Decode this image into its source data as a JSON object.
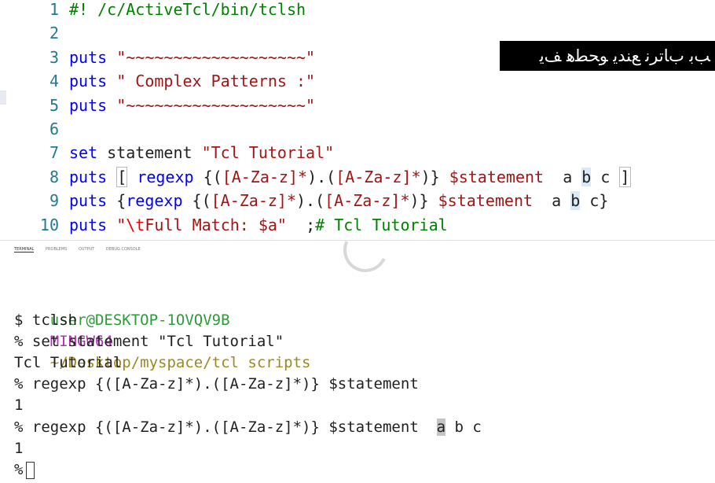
{
  "editor": {
    "lines": [
      {
        "num": "1",
        "tokens": [
          {
            "t": "#! /c/ActiveTcl/bin/tclsh",
            "c": "cmt"
          }
        ]
      },
      {
        "num": "2",
        "tokens": []
      },
      {
        "num": "3",
        "tokens": [
          {
            "t": "puts",
            "c": "kw"
          },
          {
            "t": " ",
            "c": ""
          },
          {
            "t": "\"~~~~~~~~~~~~~~~~~~~\"",
            "c": "str"
          }
        ]
      },
      {
        "num": "4",
        "tokens": [
          {
            "t": "puts",
            "c": "kw"
          },
          {
            "t": " ",
            "c": ""
          },
          {
            "t": "\" Complex Patterns :\"",
            "c": "str"
          }
        ]
      },
      {
        "num": "5",
        "tokens": [
          {
            "t": "puts",
            "c": "kw"
          },
          {
            "t": " ",
            "c": ""
          },
          {
            "t": "\"~~~~~~~~~~~~~~~~~~~\"",
            "c": "str"
          }
        ]
      },
      {
        "num": "6",
        "tokens": []
      },
      {
        "num": "7",
        "tokens": [
          {
            "t": "set",
            "c": "kw"
          },
          {
            "t": " statement ",
            "c": ""
          },
          {
            "t": "\"Tcl Tutorial\"",
            "c": "str"
          }
        ]
      },
      {
        "num": "8",
        "tokens": [
          {
            "t": "puts",
            "c": "kw"
          },
          {
            "t": " ",
            "c": ""
          },
          {
            "t": "[",
            "c": "brk"
          },
          {
            "t": " ",
            "c": ""
          },
          {
            "t": "regexp",
            "c": "kw"
          },
          {
            "t": " {(",
            "c": ""
          },
          {
            "t": "[A-Za-z]*",
            "c": "str"
          },
          {
            "t": ").(",
            "c": ""
          },
          {
            "t": "[A-Za-z]*",
            "c": "str"
          },
          {
            "t": ")} ",
            "c": ""
          },
          {
            "t": "$statement",
            "c": "str"
          },
          {
            "t": "  a ",
            "c": ""
          },
          {
            "t": "b",
            "c": "hl"
          },
          {
            "t": " c ",
            "c": ""
          },
          {
            "t": "]",
            "c": "brk"
          }
        ]
      },
      {
        "num": "9",
        "tokens": [
          {
            "t": "puts",
            "c": "kw"
          },
          {
            "t": " {",
            "c": ""
          },
          {
            "t": "regexp",
            "c": "kw"
          },
          {
            "t": " {(",
            "c": ""
          },
          {
            "t": "[A-Za-z]*",
            "c": "str"
          },
          {
            "t": ").(",
            "c": ""
          },
          {
            "t": "[A-Za-z]*",
            "c": "str"
          },
          {
            "t": ")} ",
            "c": ""
          },
          {
            "t": "$statement",
            "c": "str"
          },
          {
            "t": "  a ",
            "c": ""
          },
          {
            "t": "b",
            "c": "hl"
          },
          {
            "t": " c}",
            "c": ""
          }
        ]
      },
      {
        "num": "10",
        "tokens": [
          {
            "t": "puts",
            "c": "kw"
          },
          {
            "t": " ",
            "c": ""
          },
          {
            "t": "\"",
            "c": "str"
          },
          {
            "t": "\\t",
            "c": "esc"
          },
          {
            "t": "Full Match: $a\"",
            "c": "str"
          },
          {
            "t": "  ;",
            "c": ""
          },
          {
            "t": "# Tcl Tutorial",
            "c": "cmt"
          }
        ]
      }
    ]
  },
  "overlay_caption": "ﺐﺑ ﺏﺎﺗﺮﻧ ﻊﻨﺪﻳ ﻮﺤﻄﻫ ﻒﻳ",
  "panel": {
    "tabs": [
      "TERMINAL",
      "PROBLEMS",
      "OUTPUT",
      "DEBUG CONSOLE"
    ]
  },
  "terminal": {
    "user": "user@DESKTOP-1OVQV9B",
    "env": "MINGW64",
    "path": "~/Desktop/myspace/tcl scripts",
    "lines": [
      "$ tclsh",
      "% set statement \"Tcl Tutorial\"",
      "Tcl Tutorial",
      "% regexp {([A-Za-z]*).([A-Za-z]*)} $statement",
      "1"
    ],
    "line_sel_prefix": "% regexp {([A-Za-z]*).([A-Za-z]*)} $statement  ",
    "line_sel_char": "a",
    "line_sel_suffix": " b c",
    "result": "1",
    "prompt": "%"
  }
}
